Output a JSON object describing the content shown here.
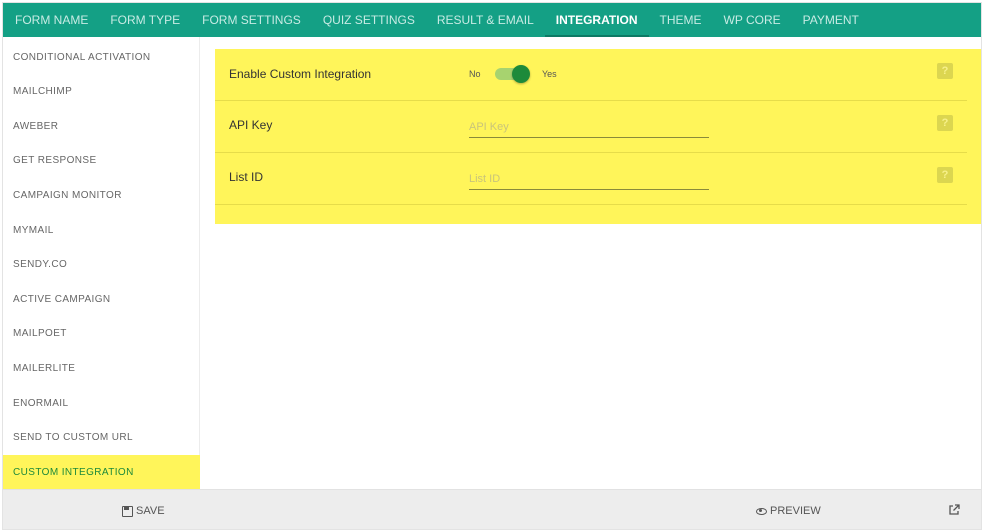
{
  "tabs": [
    {
      "label": "FORM NAME",
      "active": false
    },
    {
      "label": "FORM TYPE",
      "active": false
    },
    {
      "label": "FORM SETTINGS",
      "active": false
    },
    {
      "label": "QUIZ SETTINGS",
      "active": false
    },
    {
      "label": "RESULT & EMAIL",
      "active": false
    },
    {
      "label": "INTEGRATION",
      "active": true
    },
    {
      "label": "THEME",
      "active": false
    },
    {
      "label": "WP CORE",
      "active": false
    },
    {
      "label": "PAYMENT",
      "active": false
    }
  ],
  "sidebar": {
    "items": [
      {
        "label": "CONDITIONAL ACTIVATION",
        "active": false
      },
      {
        "label": "MAILCHIMP",
        "active": false
      },
      {
        "label": "AWEBER",
        "active": false
      },
      {
        "label": "GET RESPONSE",
        "active": false
      },
      {
        "label": "CAMPAIGN MONITOR",
        "active": false
      },
      {
        "label": "MYMAIL",
        "active": false
      },
      {
        "label": "SENDY.CO",
        "active": false
      },
      {
        "label": "ACTIVE CAMPAIGN",
        "active": false
      },
      {
        "label": "MAILPOET",
        "active": false
      },
      {
        "label": "MAILERLITE",
        "active": false
      },
      {
        "label": "ENORMAIL",
        "active": false
      },
      {
        "label": "SEND TO CUSTOM URL",
        "active": false
      },
      {
        "label": "CUSTOM INTEGRATION",
        "active": true
      }
    ]
  },
  "settings": {
    "enable": {
      "label": "Enable Custom Integration",
      "off_label": "No",
      "on_label": "Yes",
      "value": true
    },
    "api_key": {
      "label": "API Key",
      "placeholder": "API Key",
      "value": ""
    },
    "list_id": {
      "label": "List ID",
      "placeholder": "List ID",
      "value": ""
    },
    "help_glyph": "?"
  },
  "footer": {
    "save_label": "SAVE",
    "preview_label": "PREVIEW"
  },
  "icons": {
    "save": "save-icon",
    "preview": "eye-icon",
    "external": "external-link-icon",
    "help": "help-icon"
  },
  "colors": {
    "header": "#14a085",
    "highlight": "#fff55a",
    "active_text": "#1d8a3a",
    "toggle_on": "#1d8a3a"
  }
}
